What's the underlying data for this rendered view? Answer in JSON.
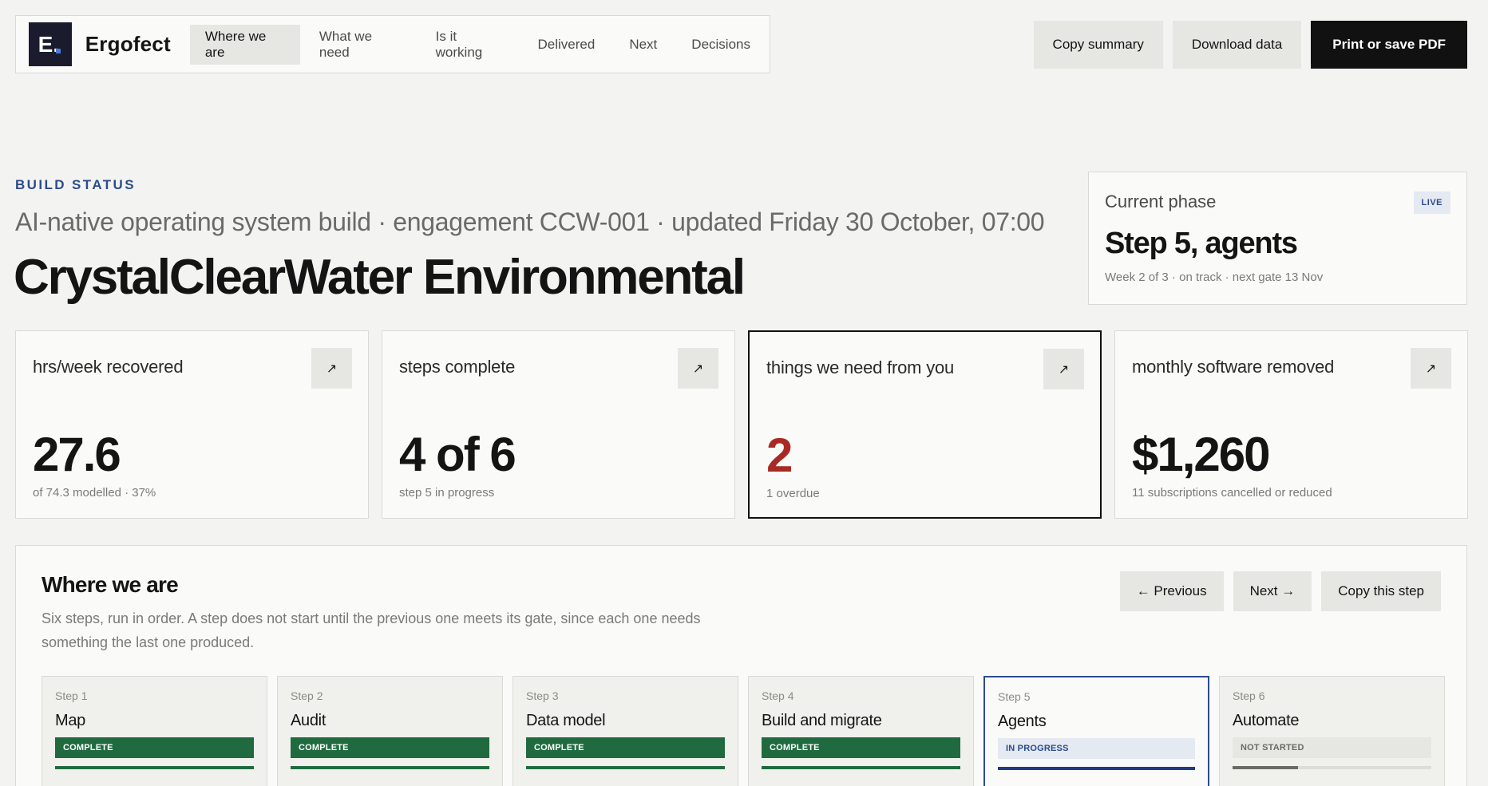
{
  "brand": {
    "logo_letter": "E.",
    "name": "Ergofect"
  },
  "nav": {
    "items": [
      {
        "label": "Where we are",
        "active": true
      },
      {
        "label": "What we need",
        "active": false
      },
      {
        "label": "Is it working",
        "active": false
      },
      {
        "label": "Delivered",
        "active": false
      },
      {
        "label": "Next",
        "active": false
      },
      {
        "label": "Decisions",
        "active": false
      }
    ]
  },
  "actions": {
    "copy_summary": "Copy summary",
    "download_data": "Download data",
    "print_pdf": "Print or save PDF"
  },
  "header": {
    "eyebrow": "BUILD STATUS",
    "subtitle": "AI-native operating system build · engagement CCW-001 · updated Friday 30 October, 07:00",
    "client": "CrystalClearWater Environmental"
  },
  "phase": {
    "label": "Current phase",
    "badge": "LIVE",
    "value": "Step 5, agents",
    "note": "Week 2 of 3 · on track · next gate 13 Nov"
  },
  "stats": [
    {
      "label": "hrs/week recovered",
      "value": "27.6",
      "note": "of 74.3 modelled · 37%",
      "button": "↗"
    },
    {
      "label": "steps complete",
      "value": "4 of 6",
      "note": "step 5 in progress",
      "button": "↗"
    },
    {
      "label": "things we need from you",
      "value": "2",
      "note": "1 overdue",
      "button": "↗"
    },
    {
      "label": "monthly software removed",
      "value": "$1,260",
      "note": "11 subscriptions cancelled or reduced",
      "button": "↗"
    }
  ],
  "panel": {
    "title": "Where we are",
    "description": "Six steps, run in order. A step does not start until the previous one meets its gate, since each one needs something the last one produced.",
    "previous": "← Previous",
    "next": "Next →",
    "copy_step": "Copy this step"
  },
  "steps": [
    {
      "num": "Step 1",
      "name": "Map",
      "status": "COMPLETE",
      "progress": 1.0
    },
    {
      "num": "Step 2",
      "name": "Audit",
      "status": "COMPLETE",
      "progress": 1.0
    },
    {
      "num": "Step 3",
      "name": "Data model",
      "status": "COMPLETE",
      "progress": 1.0
    },
    {
      "num": "Step 4",
      "name": "Build and migrate",
      "status": "COMPLETE",
      "progress": 1.0
    },
    {
      "num": "Step 5",
      "name": "Agents",
      "status": "IN PROGRESS",
      "progress": 1.0
    },
    {
      "num": "Step 6",
      "name": "Automate",
      "status": "NOT STARTED",
      "progress": 0.33
    }
  ],
  "colors": {
    "accent_blue": "#2b4c8c",
    "complete_green": "#1f6b3f",
    "alert_red": "#a92a24",
    "dark_button": "#111111"
  }
}
